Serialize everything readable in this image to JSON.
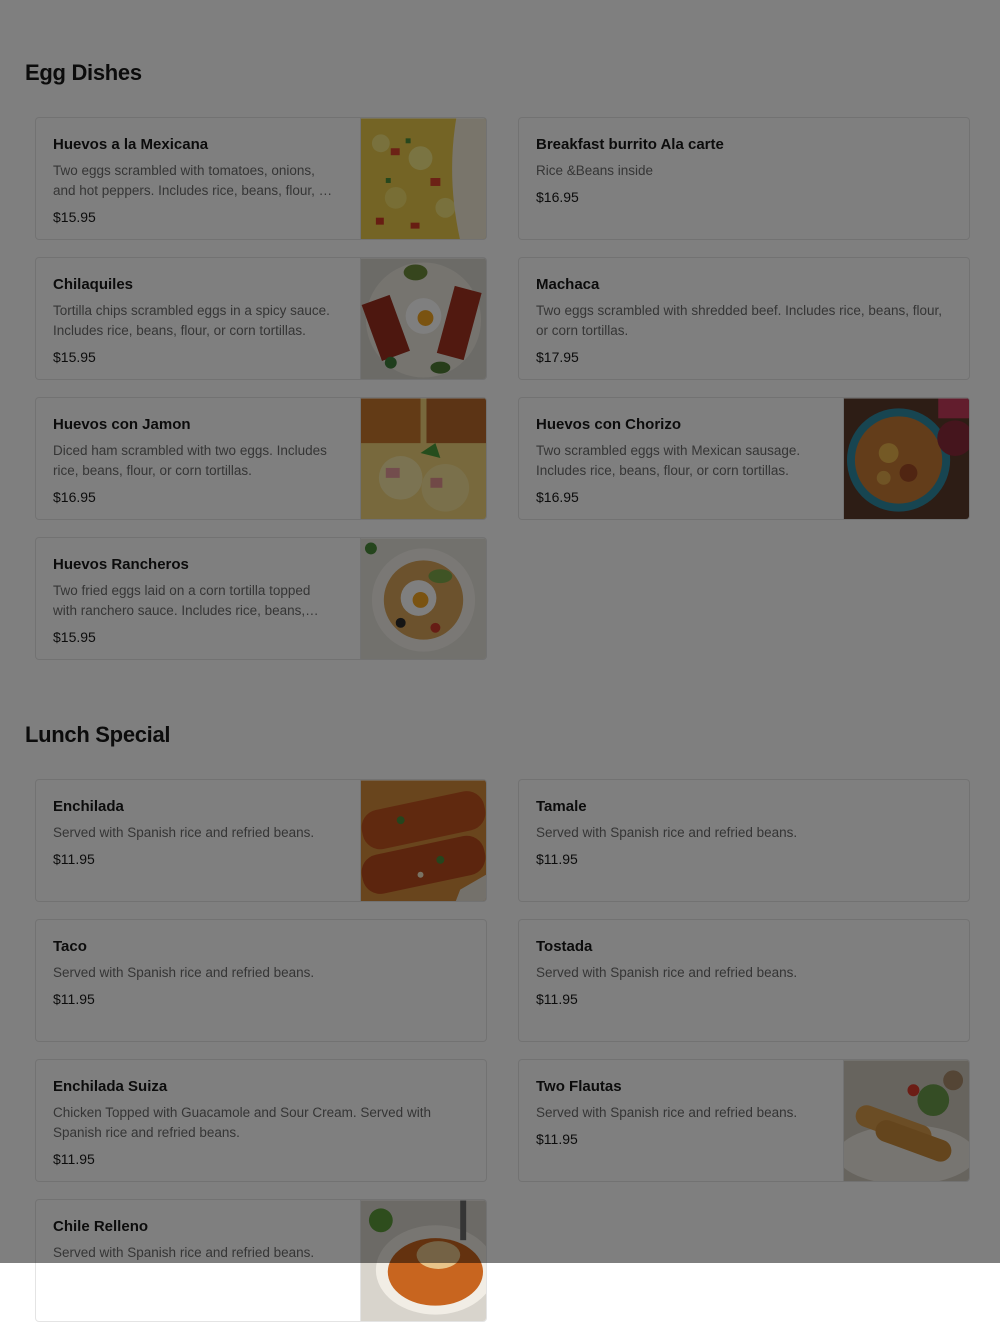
{
  "sections": [
    {
      "title": "Egg Dishes",
      "items": [
        {
          "name": "Huevos a la Mexicana",
          "desc": "Two eggs scrambled with tomatoes, onions, and hot peppers. Includes rice, beans, flour, or corn tortillas.",
          "price": "$15.95",
          "image": "huevos-mexicana-photo"
        },
        {
          "name": "Breakfast burrito Ala carte",
          "desc": "Rice &Beans inside",
          "price": "$16.95",
          "image": null
        },
        {
          "name": "Chilaquiles",
          "desc": "Tortilla chips scrambled eggs in a spicy sauce. Includes rice, beans, flour, or corn tortillas.",
          "price": "$15.95",
          "image": "chilaquiles-photo"
        },
        {
          "name": "Machaca",
          "desc": "Two eggs scrambled with shredded beef. Includes rice, beans, flour, or corn tortillas.",
          "price": "$17.95",
          "image": null
        },
        {
          "name": "Huevos con Jamon",
          "desc": "Diced ham scrambled with two eggs. Includes rice, beans, flour, or corn tortillas.",
          "price": "$16.95",
          "image": "huevos-jamon-photo"
        },
        {
          "name": "Huevos con Chorizo",
          "desc": "Two scrambled eggs with Mexican sausage. Includes rice, beans, flour, or corn tortillas.",
          "price": "$16.95",
          "image": "huevos-chorizo-photo"
        },
        {
          "name": "Huevos Rancheros",
          "desc": "Two fried eggs laid on a corn tortilla topped with ranchero sauce. Includes rice, beans, flour, or corn tortillas.",
          "price": "$15.95",
          "image": "huevos-rancheros-photo"
        }
      ]
    },
    {
      "title": "Lunch Special",
      "items": [
        {
          "name": "Enchilada",
          "desc": "Served with Spanish rice and refried beans.",
          "price": "$11.95",
          "image": "enchilada-photo"
        },
        {
          "name": "Tamale",
          "desc": "Served with Spanish rice and refried beans.",
          "price": "$11.95",
          "image": null
        },
        {
          "name": "Taco",
          "desc": "Served with Spanish rice and refried beans.",
          "price": "$11.95",
          "image": null
        },
        {
          "name": "Tostada",
          "desc": "Served with Spanish rice and refried beans.",
          "price": "$11.95",
          "image": null
        },
        {
          "name": "Enchilada Suiza",
          "desc": "Chicken Topped with Guacamole and Sour Cream. Served with Spanish rice and refried beans.",
          "price": "$11.95",
          "image": null
        },
        {
          "name": "Two Flautas",
          "desc": "Served with Spanish rice and refried beans.",
          "price": "$11.95",
          "image": "flautas-photo"
        },
        {
          "name": "Chile Relleno",
          "desc": "Served with Spanish rice and refried beans.",
          "price": "",
          "image": "chile-relleno-photo"
        }
      ]
    }
  ],
  "colors": {
    "overlay": "#000000",
    "text": "#191919",
    "muted": "#6b6b6b",
    "border": "#e4e4e4"
  }
}
